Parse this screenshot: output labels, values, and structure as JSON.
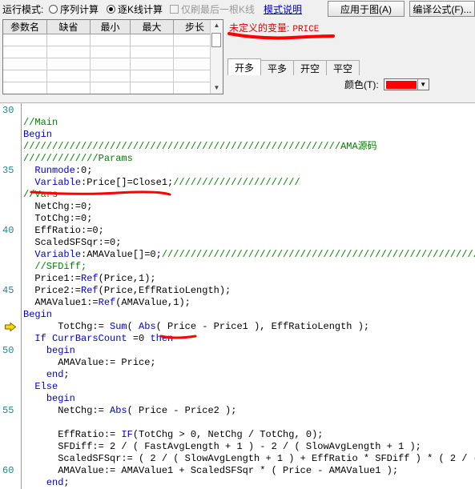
{
  "toolbar": {
    "run_mode_label": "运行模式:",
    "radio_sequence": "序列计算",
    "radio_per_bar": "逐K线计算",
    "checkbox_last_bar": "仅刷最后一根K线",
    "help_link": "模式说明",
    "apply_button": "应用于图(A)",
    "compile_button": "编译公式(F)..."
  },
  "params_table": {
    "headers": [
      "参数名",
      "缺省",
      "最小",
      "最大",
      "步长"
    ]
  },
  "undefined_vars": {
    "label": "未定义的变量:",
    "value": "PRICE"
  },
  "tabs": [
    "开多",
    "平多",
    "开空",
    "平空"
  ],
  "color": {
    "label": "颜色(T):",
    "value": "#ff0000"
  },
  "editor": {
    "line_numbers": [
      {
        "label": "30",
        "row": 0
      },
      {
        "label": "35",
        "row": 5
      },
      {
        "label": "40",
        "row": 10
      },
      {
        "label": "45",
        "row": 15
      },
      {
        "label": "50",
        "row": 20
      },
      {
        "label": "55",
        "row": 25
      },
      {
        "label": "60",
        "row": 30
      }
    ],
    "current_row": 18,
    "lines": [
      [],
      [
        {
          "t": "//Main",
          "c": "c"
        }
      ],
      [
        {
          "t": "Begin",
          "c": "k"
        }
      ],
      [
        {
          "t": "///////////////////////////////////////////////////////AMA源码",
          "c": "c"
        }
      ],
      [
        {
          "t": "/////////////Params",
          "c": "c"
        }
      ],
      [
        {
          "t": "  "
        },
        {
          "t": "Runmode",
          "c": "k"
        },
        {
          "t": ":0;"
        }
      ],
      [
        {
          "t": "  "
        },
        {
          "t": "Variable",
          "c": "k"
        },
        {
          "t": ":Price[]=Close1;"
        },
        {
          "t": "//////////////////////",
          "c": "c"
        }
      ],
      [
        {
          "t": "//Vars",
          "c": "c"
        }
      ],
      [
        {
          "t": "  NetChg:=0;"
        }
      ],
      [
        {
          "t": "  TotChg:=0;"
        }
      ],
      [
        {
          "t": "  EffRatio:=0;"
        }
      ],
      [
        {
          "t": "  ScaledSFSqr:=0;"
        }
      ],
      [
        {
          "t": "  "
        },
        {
          "t": "Variable",
          "c": "k"
        },
        {
          "t": ":AMAValue[]=0;"
        },
        {
          "t": "///////////////////////////////////////////////////////",
          "c": "c"
        }
      ],
      [
        {
          "t": "  "
        },
        {
          "t": "//SFDiff;",
          "c": "c"
        }
      ],
      [
        {
          "t": "  Price1:="
        },
        {
          "t": "Ref",
          "c": "k"
        },
        {
          "t": "(Price,1);"
        }
      ],
      [
        {
          "t": "  Price2:="
        },
        {
          "t": "Ref",
          "c": "k"
        },
        {
          "t": "(Price,EffRatioLength);"
        }
      ],
      [
        {
          "t": "  AMAValue1:="
        },
        {
          "t": "Ref",
          "c": "k"
        },
        {
          "t": "(AMAValue,1);"
        }
      ],
      [
        {
          "t": "Begin",
          "c": "k"
        }
      ],
      [
        {
          "t": "      TotChg:= "
        },
        {
          "t": "Sum",
          "c": "k"
        },
        {
          "t": "( "
        },
        {
          "t": "Abs",
          "c": "k"
        },
        {
          "t": "( Price - Price1 ), EffRatioLength );"
        }
      ],
      [
        {
          "t": "  "
        },
        {
          "t": "If",
          "c": "k"
        },
        {
          "t": " "
        },
        {
          "t": "CurrBarsCount",
          "c": "k"
        },
        {
          "t": " =0 "
        },
        {
          "t": "then",
          "c": "k"
        }
      ],
      [
        {
          "t": "    "
        },
        {
          "t": "begin",
          "c": "k"
        }
      ],
      [
        {
          "t": "      AMAValue:= Price;"
        }
      ],
      [
        {
          "t": "    "
        },
        {
          "t": "end",
          "c": "k"
        },
        {
          "t": ";"
        }
      ],
      [
        {
          "t": "  "
        },
        {
          "t": "Else",
          "c": "k"
        }
      ],
      [
        {
          "t": "    "
        },
        {
          "t": "begin",
          "c": "k"
        }
      ],
      [
        {
          "t": "      NetChg:= "
        },
        {
          "t": "Abs",
          "c": "k"
        },
        {
          "t": "( Price - Price2 );"
        }
      ],
      [],
      [
        {
          "t": "      EffRatio:= "
        },
        {
          "t": "IF",
          "c": "k"
        },
        {
          "t": "(TotChg > 0, NetChg / TotChg, 0);"
        }
      ],
      [
        {
          "t": "      SFDiff:= 2 / ( FastAvgLength + 1 ) - 2 / ( SlowAvgLength + 1 );"
        }
      ],
      [
        {
          "t": "      ScaledSFSqr:= ( 2 / ( SlowAvgLength + 1 ) + EffRatio * SFDiff ) * ( 2 / ("
        }
      ],
      [
        {
          "t": "      AMAValue:= AMAValue1 + ScaledSFSqr * ( Price - AMAValue1 );"
        }
      ],
      [
        {
          "t": "    "
        },
        {
          "t": "end",
          "c": "k"
        },
        {
          "t": ";"
        }
      ]
    ]
  },
  "colors": {
    "keyword": "#0000cc",
    "comment": "#008000",
    "text": "#000000",
    "line_number": "#218888",
    "error": "#e00000",
    "annotation": "#ff0000"
  },
  "icons": [
    "current-line-arrow-icon",
    "dropdown-arrow-icon",
    "scroll-up-icon",
    "scroll-down-icon"
  ]
}
